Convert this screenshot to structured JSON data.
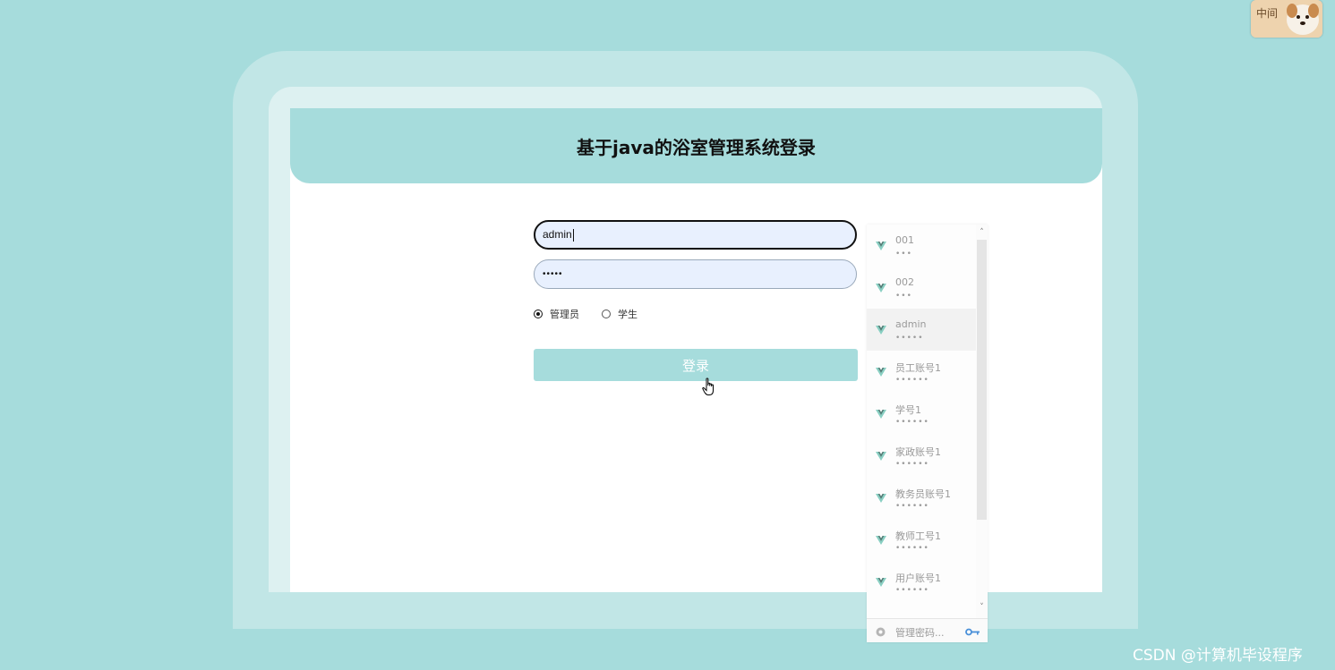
{
  "page": {
    "title": "基于java的浴室管理系统登录"
  },
  "form": {
    "username_value": "admin",
    "password_value": "•••••",
    "roles": [
      {
        "label": "管理员",
        "checked": true
      },
      {
        "label": "学生",
        "checked": false
      }
    ],
    "login_label": "登录"
  },
  "autofill": {
    "items": [
      {
        "name": "001",
        "mask": "•••"
      },
      {
        "name": "002",
        "mask": "•••"
      },
      {
        "name": "admin",
        "mask": "•••••"
      },
      {
        "name": "员工账号1",
        "mask": "••••••"
      },
      {
        "name": "学号1",
        "mask": "••••••"
      },
      {
        "name": "家政账号1",
        "mask": "••••••"
      },
      {
        "name": "教务员账号1",
        "mask": "••••••"
      },
      {
        "name": "教师工号1",
        "mask": "••••••"
      },
      {
        "name": "用户账号1",
        "mask": "••••••"
      }
    ],
    "active_index": 2,
    "manage_label": "管理密码..."
  },
  "avatar": {
    "text": "中间"
  },
  "watermark": "CSDN @计算机毕设程序",
  "colors": {
    "background": "#a6dcdc",
    "frame_outer": "#c1e6e6",
    "frame_inner": "#ddf1f1",
    "input_fill": "#e8f0fe",
    "accent": "#a6dcdc"
  }
}
